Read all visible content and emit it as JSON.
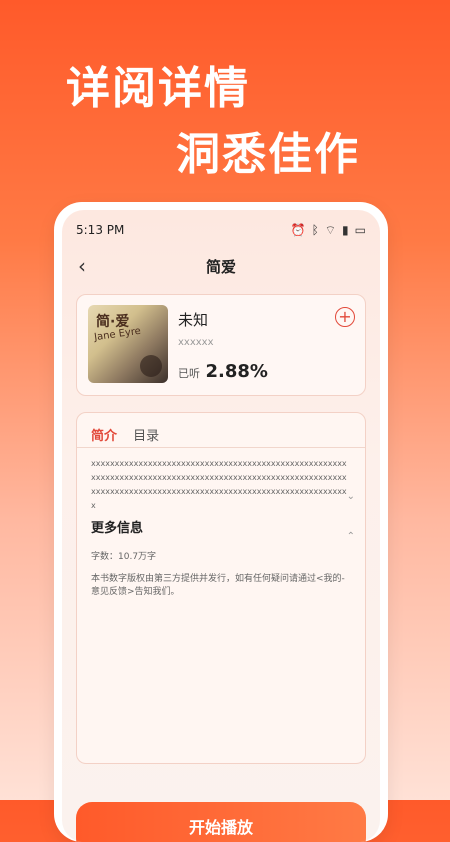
{
  "headline": {
    "line1": "详阅详情",
    "line2": "洞悉佳作"
  },
  "status_bar": {
    "time": "5:13 PM",
    "icons": [
      "alarm-icon",
      "bluetooth-icon",
      "wifi-icon",
      "signal-icon",
      "battery-icon"
    ]
  },
  "nav": {
    "back_label": "‹",
    "title": "简爱"
  },
  "book": {
    "cover_title": "简·爱",
    "cover_subtitle": "Jane Eyre",
    "name": "未知",
    "author": "xxxxxx",
    "listened_label": "已听",
    "listened_percent": "2.88%"
  },
  "detail": {
    "tabs": [
      {
        "label": "简介",
        "active": true
      },
      {
        "label": "目录",
        "active": false
      }
    ],
    "description": "xxxxxxxxxxxxxxxxxxxxxxxxxxxxxxxxxxxxxxxxxxxxxxxxxxxxxxxxxxxxxxxxxxxxxxxxxxxxxxxxxxxxxxxxxxxxxxxxxxxxxxxxxxxxxxxxxxxxxxxxxxxxxxxxxxxxxxxxxxxxxxxxxxxxxxxxxxxxxxxxxxx",
    "more_title": "更多信息",
    "word_count": "字数：10.7万字",
    "notice": "本书数字版权由第三方提供并发行，如有任何疑问请通过<我的-意见反馈>告知我们。"
  },
  "play_button": {
    "label": "开始播放"
  },
  "colors": {
    "accent": "#e2493a",
    "gradient_top": "#ff5a2a"
  }
}
